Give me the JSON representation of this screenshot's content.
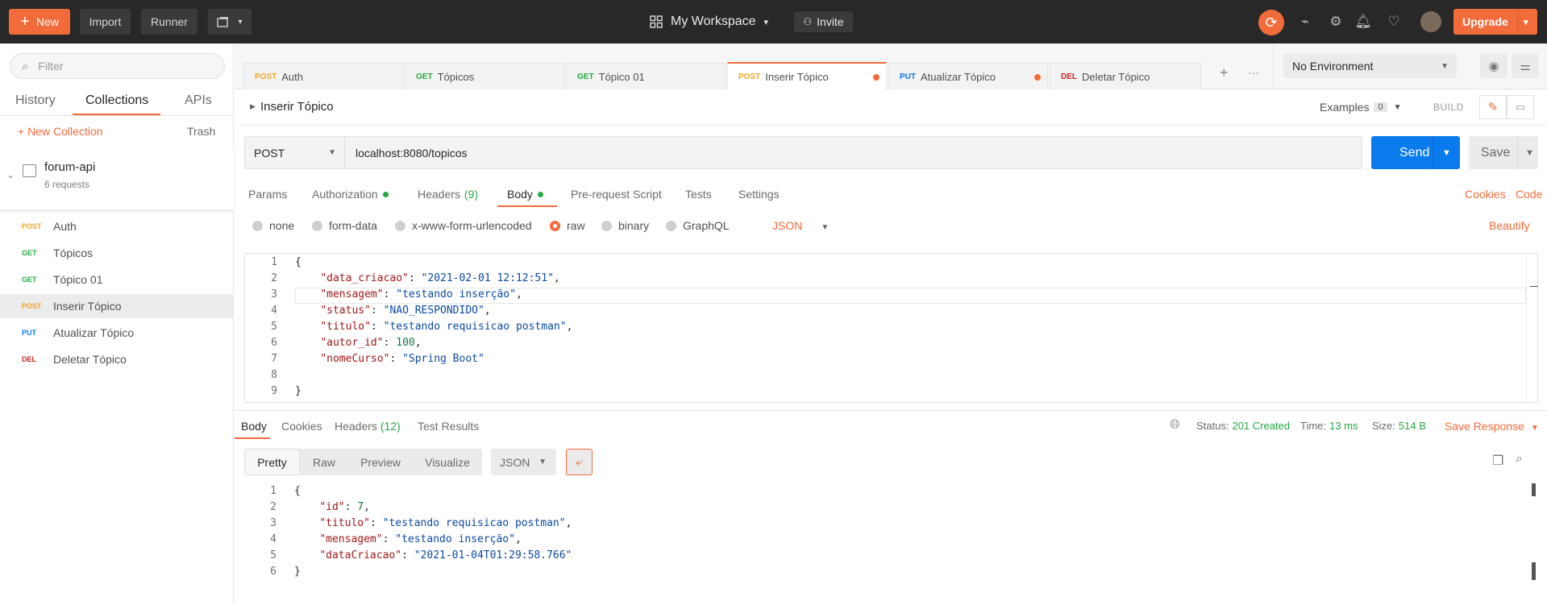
{
  "topbar": {
    "new_label": "New",
    "import_label": "Import",
    "runner_label": "Runner",
    "workspace_label": "My Workspace",
    "invite_label": "Invite",
    "upgrade_label": "Upgrade",
    "accent_color": "#f26b3a",
    "icons": [
      "new-window-icon",
      "grid-icon",
      "chevron-down-icon",
      "add-person-icon",
      "sync-icon",
      "satellite-icon",
      "settings-icon",
      "bell-icon",
      "heart-icon",
      "avatar"
    ]
  },
  "sidebar": {
    "filter_placeholder": "Filter",
    "tabs": [
      "History",
      "Collections",
      "APIs"
    ],
    "active_tab": "Collections",
    "new_collection_label": "+ New Collection",
    "trash_label": "Trash",
    "collection": {
      "name": "forum-api",
      "count": "6 requests",
      "requests": [
        {
          "method": "POST",
          "name": "Auth"
        },
        {
          "method": "GET",
          "name": "Tópicos"
        },
        {
          "method": "GET",
          "name": "Tópico 01"
        },
        {
          "method": "POST",
          "name": "Inserir Tópico"
        },
        {
          "method": "PUT",
          "name": "Atualizar Tópico"
        },
        {
          "method": "DEL",
          "name": "Deletar Tópico"
        }
      ]
    }
  },
  "method_colors": {
    "POST": "#f5a623",
    "GET": "#27a844",
    "PUT": "#097bed",
    "DEL": "#d11f1f"
  },
  "tabs": [
    {
      "method": "POST",
      "name": "Auth"
    },
    {
      "method": "GET",
      "name": "Tópicos"
    },
    {
      "method": "GET",
      "name": "Tópico 01"
    },
    {
      "method": "POST",
      "name": "Inserir Tópico"
    },
    {
      "method": "PUT",
      "name": "Atualizar Tópico"
    },
    {
      "method": "DEL",
      "name": "Deletar Tópico"
    }
  ],
  "active_tab_index": 3,
  "environment": {
    "selected": "No Environment"
  },
  "request": {
    "title": "Inserir Tópico",
    "examples_label": "Examples",
    "examples_count": "0",
    "build_label": "BUILD",
    "method": "POST",
    "url": "localhost:8080/topicos",
    "send_label": "Send",
    "save_label": "Save",
    "subtabs": {
      "params": "Params",
      "authorization": "Authorization",
      "headers": "Headers",
      "headers_count": "(9)",
      "body": "Body",
      "prerequest": "Pre-request Script",
      "tests": "Tests",
      "settings": "Settings"
    },
    "cookies_label": "Cookies",
    "code_label": "Code",
    "body_modes": [
      "none",
      "form-data",
      "x-www-form-urlencoded",
      "raw",
      "binary",
      "GraphQL"
    ],
    "body_mode_selected": "raw",
    "body_format": "JSON",
    "beautify_label": "Beautify",
    "body_lines": [
      {
        "n": "1",
        "t": "{"
      },
      {
        "n": "2",
        "t": "    \"data_criacao\": \"2021-02-01 12:12:51\","
      },
      {
        "n": "3",
        "t": "    \"mensagem\": \"testando inserção\","
      },
      {
        "n": "4",
        "t": "    \"status\": \"NAO_RESPONDIDO\","
      },
      {
        "n": "5",
        "t": "    \"titulo\": \"testando requisicao postman\","
      },
      {
        "n": "6",
        "t": "    \"autor_id\": 100,"
      },
      {
        "n": "7",
        "t": "    \"nomeCurso\": \"Spring Boot\""
      },
      {
        "n": "8",
        "t": ""
      },
      {
        "n": "9",
        "t": "}"
      }
    ]
  },
  "response": {
    "tabs": {
      "body": "Body",
      "cookies": "Cookies",
      "headers": "Headers",
      "headers_count": "(12)",
      "tests": "Test Results"
    },
    "status_label": "Status:",
    "status_value": "201 Created",
    "time_label": "Time:",
    "time_value": "13 ms",
    "size_label": "Size:",
    "size_value": "514 B",
    "save_response_label": "Save Response",
    "views": [
      "Pretty",
      "Raw",
      "Preview",
      "Visualize"
    ],
    "active_view": "Pretty",
    "format": "JSON",
    "body_lines": [
      {
        "n": "1",
        "t": "{"
      },
      {
        "n": "2",
        "t": "    \"id\": 7,"
      },
      {
        "n": "3",
        "t": "    \"titulo\": \"testando requisicao postman\","
      },
      {
        "n": "4",
        "t": "    \"mensagem\": \"testando inserção\","
      },
      {
        "n": "5",
        "t": "    \"dataCriacao\": \"2021-01-04T01:29:58.766\""
      },
      {
        "n": "6",
        "t": "}"
      }
    ]
  }
}
